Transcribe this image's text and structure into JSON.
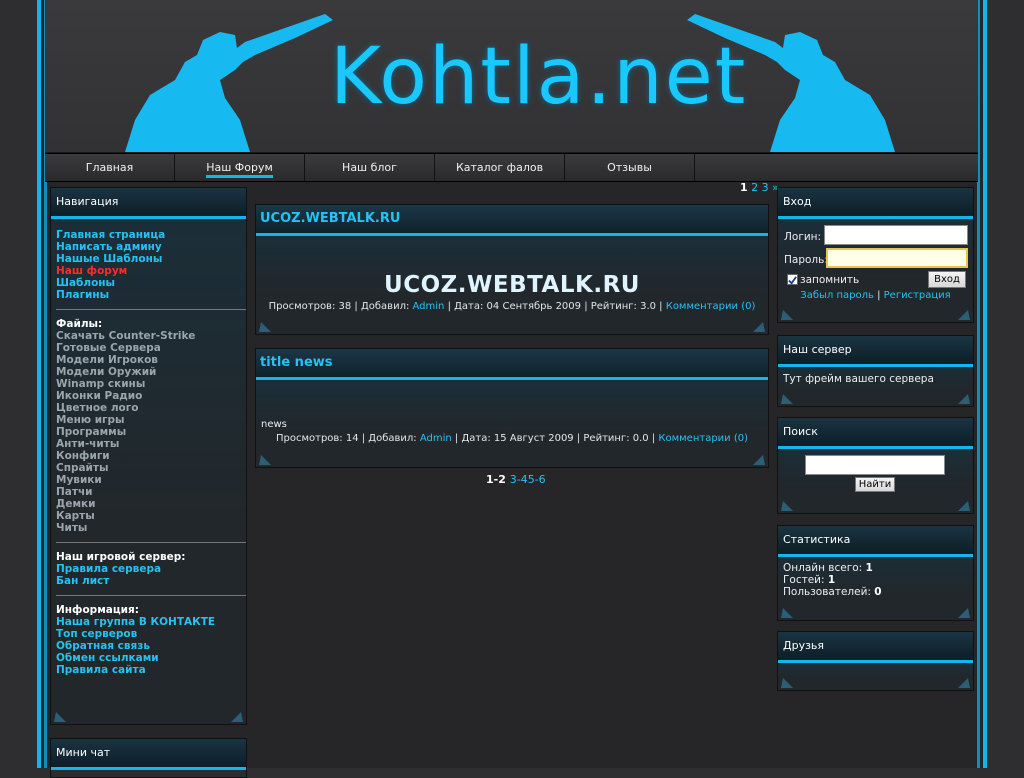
{
  "header": {
    "logo_text": "Kohtla.net"
  },
  "nav": {
    "items": [
      "Главная",
      "Наш Форум",
      "Наш блог",
      "Каталог фалов",
      "Отзывы"
    ],
    "active_index": 1
  },
  "pager_top": {
    "current": "1",
    "p2": "2",
    "p3": "3",
    "next": "»"
  },
  "left_nav": {
    "title": "Навигация",
    "main_links": [
      "Главная страница",
      "Написать админу",
      "Нашые Шаблоны",
      "Наш форум",
      "Шаблоны",
      "Плагины"
    ],
    "files_title": "Файлы:",
    "files_links": [
      "Скачать Counter-Strike",
      "Готовые Сервера",
      "Модели Игроков",
      "Модели Оружий",
      "Winamp скины",
      "Иконки Радио",
      "Цветное лого",
      "Меню игры",
      "Программы",
      "Анти-читы",
      "Конфиги",
      "Спрайты",
      "Мувики",
      "Патчи",
      "Демки",
      "Карты",
      "Читы"
    ],
    "server_title": "Наш игровой сервер:",
    "server_links": [
      "Правила сервера",
      "Бан лист"
    ],
    "info_title": "Информация:",
    "info_links": [
      "Наша группа В КОНТАКТЕ",
      "Топ серверов",
      "Обратная связь",
      "Обмен ссылками",
      "Правила сайта"
    ]
  },
  "mini_chat": {
    "title": "Мини чат"
  },
  "news": [
    {
      "title": "UCOZ.WEBTALK.RU",
      "big_text": "UCOZ.WEBTALK.RU",
      "body": "",
      "views_label": "Просмотров: 38 | Добавил: ",
      "author": "Admin",
      "date_label": " | Дата: 04 Сентябрь 2009 | Рейтинг: 3.0 | ",
      "comments": "Комментарии (0)"
    },
    {
      "title": "title news",
      "big_text": "",
      "body": "news",
      "views_label": "Просмотров: 14 | Добавил: ",
      "author": "Admin",
      "date_label": " | Дата: 15 Август 2009 | Рейтинг: 0.0 | ",
      "comments": "Комментарии (0)"
    }
  ],
  "pager_bottom": {
    "current": "1-2",
    "p2": "3-4",
    "p3": "5-6"
  },
  "login": {
    "title": "Вход",
    "login_label": "Логин:",
    "password_label": "Пароль:",
    "remember_label": "запомнить",
    "submit": "Вход",
    "forgot": "Забыл пароль",
    "separator": "|",
    "register": "Регистрация"
  },
  "server": {
    "title": "Наш сервер",
    "text": "Тут фрейм вашего сервера"
  },
  "search": {
    "title": "Поиск",
    "button": "Найти"
  },
  "stats": {
    "title": "Статистика",
    "online_label": "Онлайн всего: ",
    "online": "1",
    "guests_label": "Гостей: ",
    "guests": "1",
    "users_label": "Пользователей: ",
    "users": "0"
  },
  "friends": {
    "title": "Друзья"
  },
  "colors": {
    "accent": "#12b6ec",
    "link": "#26c2f1",
    "active_link": "#ff2a2a",
    "background": "#2e2e30"
  }
}
